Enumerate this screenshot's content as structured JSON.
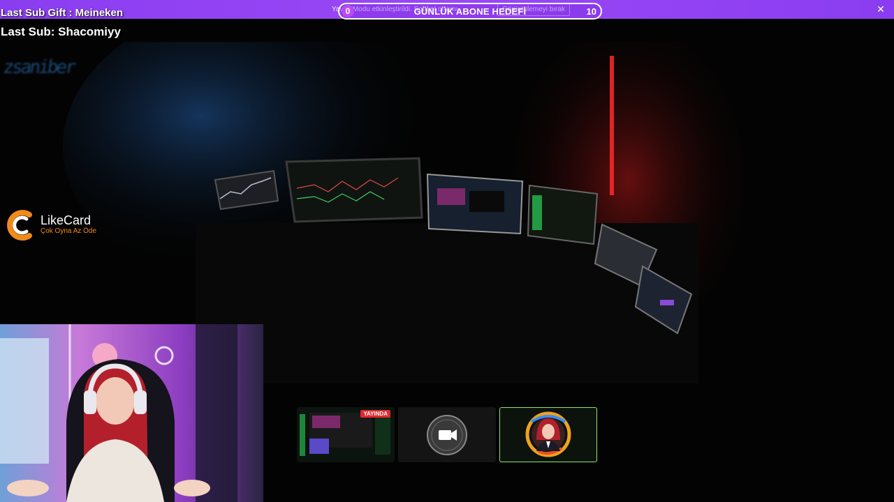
{
  "overlay": {
    "last_sub_gift": "Last Sub Gift : Meineken",
    "last_sub": "Last Sub: Shacomiyy",
    "glitch_text": "zsaniber"
  },
  "notification_bar": {
    "message": "Yavaş Modu etkinleştirildi. Sohbet ortamı",
    "action_label": "Görüntülemeyi bırak",
    "close_icon": "close-icon",
    "color": "#9b48f6"
  },
  "goal": {
    "title": "GÜNLÜK ABONE HEDEFİ",
    "current": "0",
    "target": "10",
    "progress_fraction": 0.0
  },
  "sponsor": {
    "name": "LikeCard",
    "slogan": "Çok Oyna  Az Öde",
    "accent": "#f08a1a"
  },
  "stream_cards": [
    {
      "badge": "YAYINDA",
      "icon": "stream-preview-thumbnail"
    },
    {
      "icon": "camera-icon"
    },
    {
      "icon": "streamer-avatar",
      "selected_color": "#8ee36a"
    }
  ]
}
